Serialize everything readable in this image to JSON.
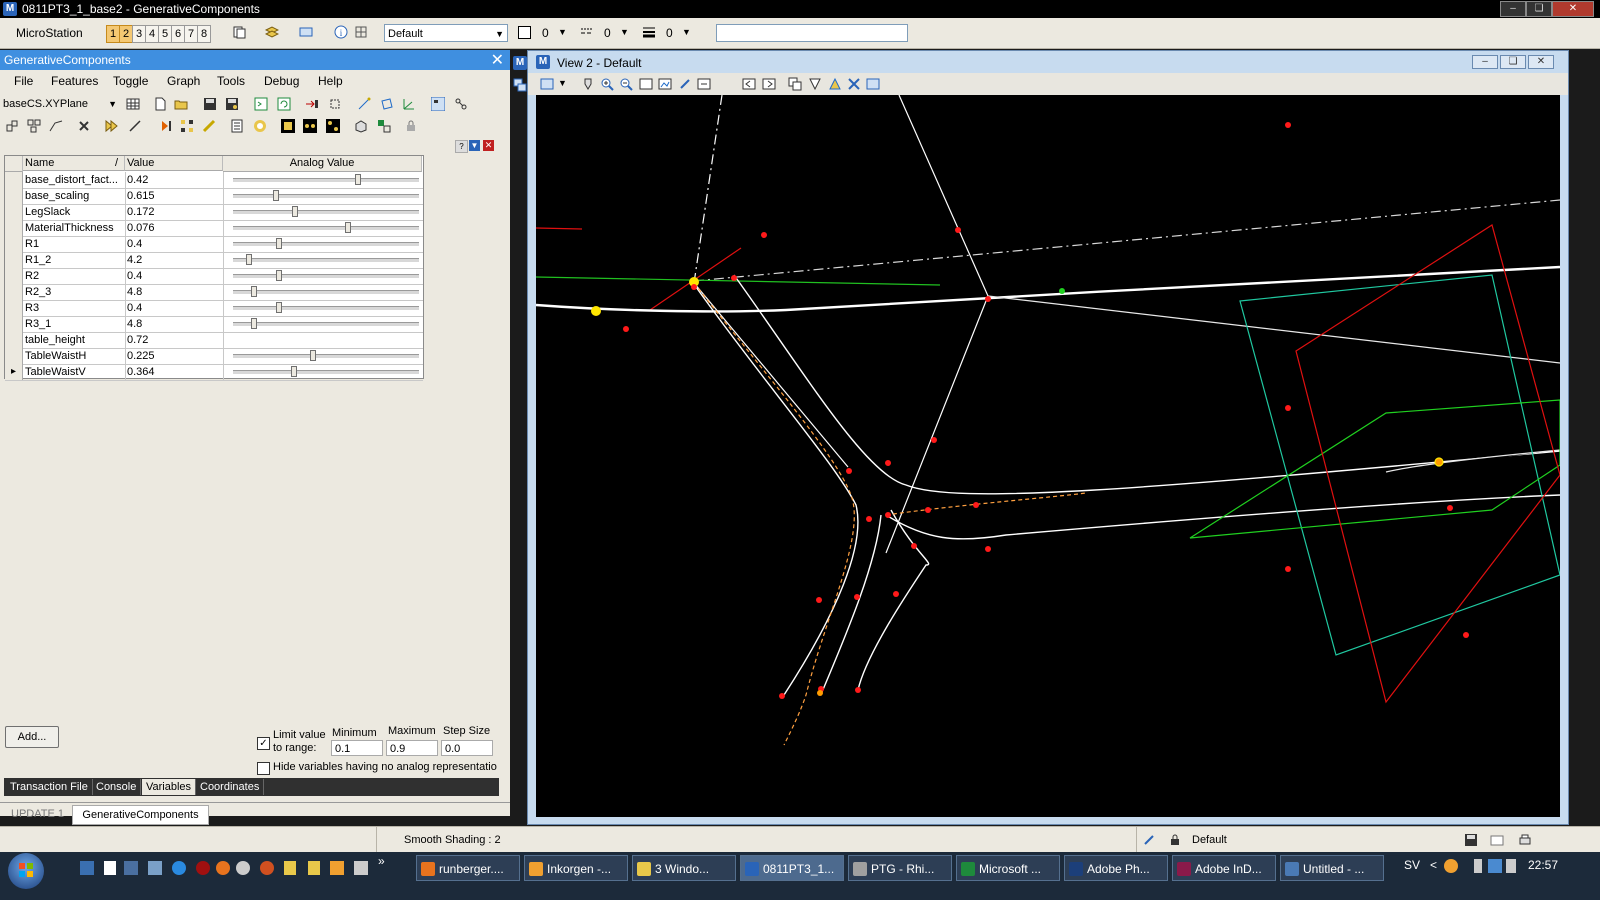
{
  "window": {
    "title": "0811PT3_1_base2 - GenerativeComponents"
  },
  "ms_toolbar": {
    "label": "MicroStation",
    "view_numbers": [
      "1",
      "2",
      "3",
      "4",
      "5",
      "6",
      "7",
      "8"
    ],
    "level_combo": "Default",
    "color_value": "0",
    "style_value": "0",
    "weight_value": "0"
  },
  "gc_panel": {
    "title": "GenerativeComponents",
    "menu": [
      "File",
      "Features",
      "Toggle",
      "Graph",
      "Tools",
      "Debug",
      "Help"
    ],
    "cs_combo": "baseCS.XYPlane",
    "columns": {
      "name": "Name",
      "sort": "/",
      "value": "Value",
      "analog": "Analog Value"
    },
    "variables": [
      {
        "name": "base_distort_fact...",
        "value": "0.42",
        "slider": 0.68
      },
      {
        "name": "base_scaling",
        "value": "0.615",
        "slider": 0.22
      },
      {
        "name": "LegSlack",
        "value": "0.172",
        "slider": 0.33
      },
      {
        "name": "MaterialThickness",
        "value": "0.076",
        "slider": 0.62
      },
      {
        "name": "R1",
        "value": "0.4",
        "slider": 0.24
      },
      {
        "name": "R1_2",
        "value": "4.2",
        "slider": 0.07
      },
      {
        "name": "R2",
        "value": "0.4",
        "slider": 0.24
      },
      {
        "name": "R2_3",
        "value": "4.8",
        "slider": 0.1
      },
      {
        "name": "R3",
        "value": "0.4",
        "slider": 0.24
      },
      {
        "name": "R3_1",
        "value": "4.8",
        "slider": 0.1
      },
      {
        "name": "table_height",
        "value": "0.72",
        "slider": null
      },
      {
        "name": "TableWaistH",
        "value": "0.225",
        "slider": 0.43
      },
      {
        "name": "TableWaistV",
        "value": "0.364",
        "slider": 0.32
      }
    ],
    "add_button": "Add...",
    "limit_label_1": "Limit value",
    "limit_label_2": "to range:",
    "limit_checked": true,
    "minimum_label": "Minimum",
    "maximum_label": "Maximum",
    "step_label": "Step Size",
    "minimum_value": "0.1",
    "maximum_value": "0.9",
    "step_value": "0.0",
    "hide_label": "Hide variables having no analog representatio",
    "tabs": [
      "Transaction File",
      "Console",
      "Variables",
      "Coordinates"
    ],
    "selected_tab": "Variables",
    "bottom_tabs": [
      "UPDATE 1",
      "GenerativeComponents"
    ]
  },
  "view": {
    "title": "View 2 - Default"
  },
  "status": {
    "shading": "Smooth Shading : 2",
    "level": "Default"
  },
  "taskbar": {
    "items": [
      {
        "label": "runberger....",
        "color": "#e8731e"
      },
      {
        "label": "Inkorgen -...",
        "color": "#f0a030"
      },
      {
        "label": "3 Windo...",
        "color": "#e8c84a"
      },
      {
        "label": "0811PT3_1...",
        "color": "#2a64b8"
      },
      {
        "label": "PTG - Rhi...",
        "color": "#a0a0a0"
      },
      {
        "label": "Microsoft ...",
        "color": "#1e8a3c"
      },
      {
        "label": "Adobe Ph...",
        "color": "#1c3f7a"
      },
      {
        "label": "Adobe InD...",
        "color": "#8a1a4a"
      },
      {
        "label": "Untitled - ...",
        "color": "#4a7ab5"
      }
    ],
    "lang": "SV",
    "time": "22:57"
  }
}
